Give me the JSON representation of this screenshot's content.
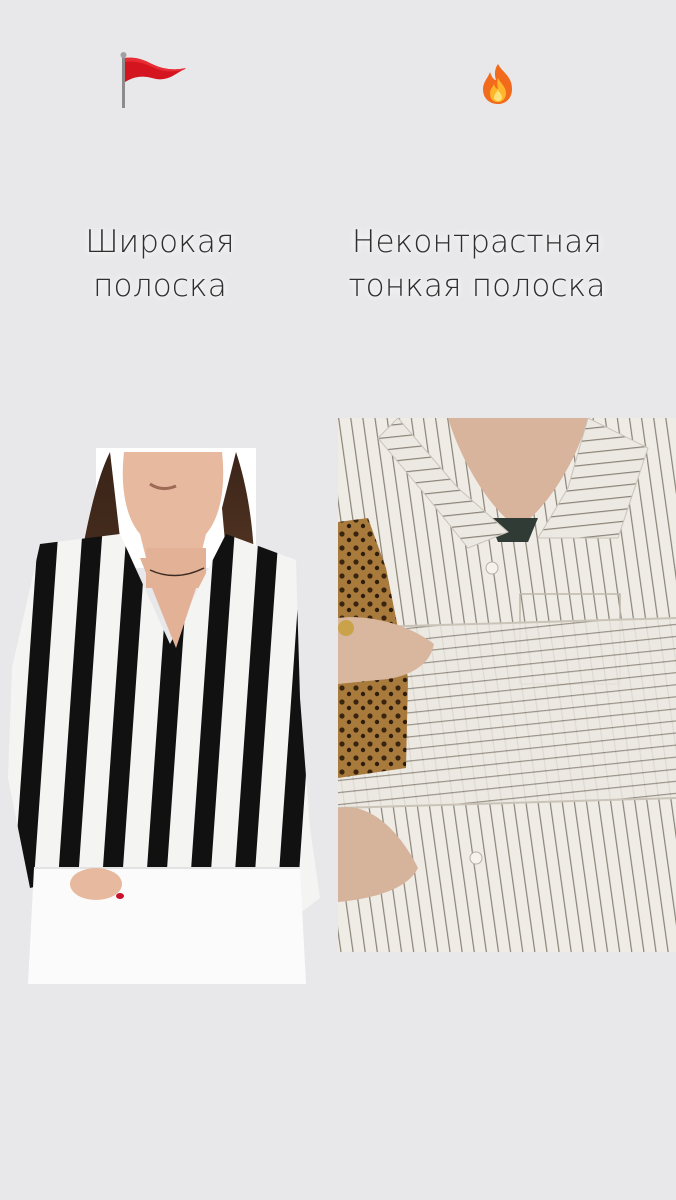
{
  "left_column": {
    "line1": "Широкая",
    "line2": "полоска",
    "emoji_icon": "red-flag-icon",
    "photo": "wide-black-white-stripe-blouse-photo"
  },
  "right_column": {
    "line1": "Неконтрастная",
    "line2": "тонкая полоска",
    "emoji_icon": "fire-icon",
    "photo": "thin-low-contrast-stripe-shirt-photo"
  },
  "colors": {
    "background": "#e8e8ea",
    "text": "#2e2e2e",
    "flag_red": "#d4151f",
    "fire_orange": "#f4801f"
  }
}
